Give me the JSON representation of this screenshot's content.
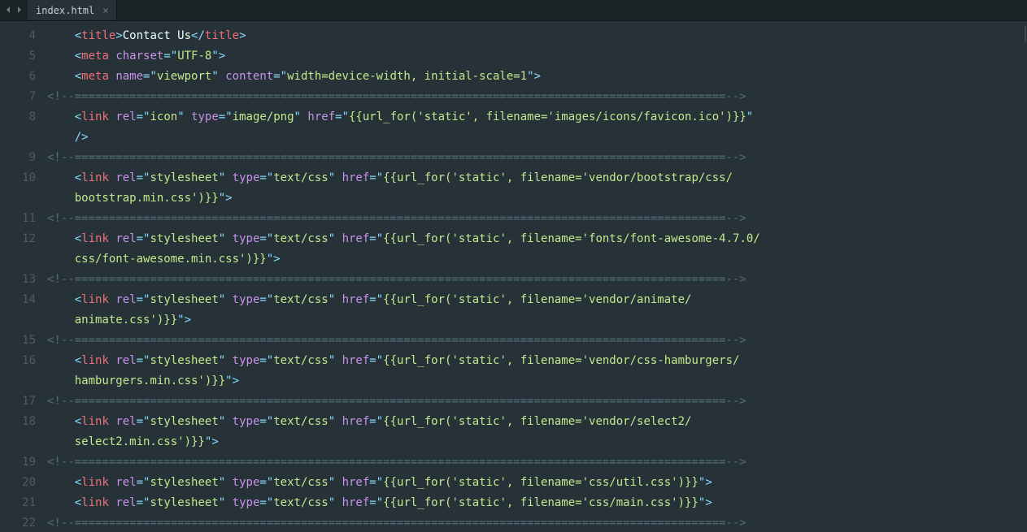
{
  "tab": {
    "filename": "index.html"
  },
  "gutter": [
    "4",
    "5",
    "6",
    "7",
    "8",
    "",
    "9",
    "10",
    "",
    "11",
    "12",
    "",
    "13",
    "14",
    "",
    "15",
    "16",
    "",
    "17",
    "18",
    "",
    "19",
    "20",
    "21",
    "22"
  ],
  "lines": [
    [
      {
        "k": "sp",
        "v": "    "
      },
      {
        "k": "punct",
        "v": "<"
      },
      {
        "k": "tagname",
        "v": "title"
      },
      {
        "k": "punct",
        "v": ">"
      },
      {
        "k": "text",
        "v": "Contact Us"
      },
      {
        "k": "punct",
        "v": "</"
      },
      {
        "k": "tagname",
        "v": "title"
      },
      {
        "k": "punct",
        "v": ">"
      }
    ],
    [
      {
        "k": "sp",
        "v": "    "
      },
      {
        "k": "punct",
        "v": "<"
      },
      {
        "k": "tagname",
        "v": "meta"
      },
      {
        "k": "sp",
        "v": " "
      },
      {
        "k": "attr",
        "v": "charset"
      },
      {
        "k": "op",
        "v": "="
      },
      {
        "k": "punct",
        "v": "\""
      },
      {
        "k": "str",
        "v": "UTF-8"
      },
      {
        "k": "punct",
        "v": "\""
      },
      {
        "k": "punct",
        "v": ">"
      }
    ],
    [
      {
        "k": "sp",
        "v": "    "
      },
      {
        "k": "punct",
        "v": "<"
      },
      {
        "k": "tagname",
        "v": "meta"
      },
      {
        "k": "sp",
        "v": " "
      },
      {
        "k": "attr",
        "v": "name"
      },
      {
        "k": "op",
        "v": "="
      },
      {
        "k": "punct",
        "v": "\""
      },
      {
        "k": "str",
        "v": "viewport"
      },
      {
        "k": "punct",
        "v": "\""
      },
      {
        "k": "sp",
        "v": " "
      },
      {
        "k": "attr",
        "v": "content"
      },
      {
        "k": "op",
        "v": "="
      },
      {
        "k": "punct",
        "v": "\""
      },
      {
        "k": "str",
        "v": "width=device-width, initial-scale=1"
      },
      {
        "k": "punct",
        "v": "\""
      },
      {
        "k": "punct",
        "v": ">"
      }
    ],
    [
      {
        "k": "comment",
        "v": "<!--===============================================================================================-->"
      }
    ],
    [
      {
        "k": "sp",
        "v": "    "
      },
      {
        "k": "punct",
        "v": "<"
      },
      {
        "k": "tagname",
        "v": "link"
      },
      {
        "k": "sp",
        "v": " "
      },
      {
        "k": "attr",
        "v": "rel"
      },
      {
        "k": "op",
        "v": "="
      },
      {
        "k": "punct",
        "v": "\""
      },
      {
        "k": "str",
        "v": "icon"
      },
      {
        "k": "punct",
        "v": "\""
      },
      {
        "k": "sp",
        "v": " "
      },
      {
        "k": "attr",
        "v": "type"
      },
      {
        "k": "op",
        "v": "="
      },
      {
        "k": "punct",
        "v": "\""
      },
      {
        "k": "str",
        "v": "image/png"
      },
      {
        "k": "punct",
        "v": "\""
      },
      {
        "k": "sp",
        "v": " "
      },
      {
        "k": "attr",
        "v": "href"
      },
      {
        "k": "op",
        "v": "="
      },
      {
        "k": "punct",
        "v": "\""
      },
      {
        "k": "str",
        "v": "{{url_for('static', filename='images/icons/favicon.ico')}}"
      },
      {
        "k": "punct",
        "v": "\""
      }
    ],
    [
      {
        "k": "sp",
        "v": "    "
      },
      {
        "k": "punct",
        "v": "/>"
      }
    ],
    [
      {
        "k": "comment",
        "v": "<!--===============================================================================================-->"
      }
    ],
    [
      {
        "k": "sp",
        "v": "    "
      },
      {
        "k": "punct",
        "v": "<"
      },
      {
        "k": "tagname",
        "v": "link"
      },
      {
        "k": "sp",
        "v": " "
      },
      {
        "k": "attr",
        "v": "rel"
      },
      {
        "k": "op",
        "v": "="
      },
      {
        "k": "punct",
        "v": "\""
      },
      {
        "k": "str",
        "v": "stylesheet"
      },
      {
        "k": "punct",
        "v": "\""
      },
      {
        "k": "sp",
        "v": " "
      },
      {
        "k": "attr",
        "v": "type"
      },
      {
        "k": "op",
        "v": "="
      },
      {
        "k": "punct",
        "v": "\""
      },
      {
        "k": "str",
        "v": "text/css"
      },
      {
        "k": "punct",
        "v": "\""
      },
      {
        "k": "sp",
        "v": " "
      },
      {
        "k": "attr",
        "v": "href"
      },
      {
        "k": "op",
        "v": "="
      },
      {
        "k": "punct",
        "v": "\""
      },
      {
        "k": "str",
        "v": "{{url_for('static', filename='vendor/bootstrap/css/"
      }
    ],
    [
      {
        "k": "sp",
        "v": "    "
      },
      {
        "k": "str",
        "v": "bootstrap.min.css')}}"
      },
      {
        "k": "punct",
        "v": "\""
      },
      {
        "k": "punct",
        "v": ">"
      }
    ],
    [
      {
        "k": "comment",
        "v": "<!--===============================================================================================-->"
      }
    ],
    [
      {
        "k": "sp",
        "v": "    "
      },
      {
        "k": "punct",
        "v": "<"
      },
      {
        "k": "tagname",
        "v": "link"
      },
      {
        "k": "sp",
        "v": " "
      },
      {
        "k": "attr",
        "v": "rel"
      },
      {
        "k": "op",
        "v": "="
      },
      {
        "k": "punct",
        "v": "\""
      },
      {
        "k": "str",
        "v": "stylesheet"
      },
      {
        "k": "punct",
        "v": "\""
      },
      {
        "k": "sp",
        "v": " "
      },
      {
        "k": "attr",
        "v": "type"
      },
      {
        "k": "op",
        "v": "="
      },
      {
        "k": "punct",
        "v": "\""
      },
      {
        "k": "str",
        "v": "text/css"
      },
      {
        "k": "punct",
        "v": "\""
      },
      {
        "k": "sp",
        "v": " "
      },
      {
        "k": "attr",
        "v": "href"
      },
      {
        "k": "op",
        "v": "="
      },
      {
        "k": "punct",
        "v": "\""
      },
      {
        "k": "str",
        "v": "{{url_for('static', filename='fonts/font-awesome-4.7.0/"
      }
    ],
    [
      {
        "k": "sp",
        "v": "    "
      },
      {
        "k": "str",
        "v": "css/font-awesome.min.css')}}"
      },
      {
        "k": "punct",
        "v": "\""
      },
      {
        "k": "punct",
        "v": ">"
      }
    ],
    [
      {
        "k": "comment",
        "v": "<!--===============================================================================================-->"
      }
    ],
    [
      {
        "k": "sp",
        "v": "    "
      },
      {
        "k": "punct",
        "v": "<"
      },
      {
        "k": "tagname",
        "v": "link"
      },
      {
        "k": "sp",
        "v": " "
      },
      {
        "k": "attr",
        "v": "rel"
      },
      {
        "k": "op",
        "v": "="
      },
      {
        "k": "punct",
        "v": "\""
      },
      {
        "k": "str",
        "v": "stylesheet"
      },
      {
        "k": "punct",
        "v": "\""
      },
      {
        "k": "sp",
        "v": " "
      },
      {
        "k": "attr",
        "v": "type"
      },
      {
        "k": "op",
        "v": "="
      },
      {
        "k": "punct",
        "v": "\""
      },
      {
        "k": "str",
        "v": "text/css"
      },
      {
        "k": "punct",
        "v": "\""
      },
      {
        "k": "sp",
        "v": " "
      },
      {
        "k": "attr",
        "v": "href"
      },
      {
        "k": "op",
        "v": "="
      },
      {
        "k": "punct",
        "v": "\""
      },
      {
        "k": "str",
        "v": "{{url_for('static', filename='vendor/animate/"
      }
    ],
    [
      {
        "k": "sp",
        "v": "    "
      },
      {
        "k": "str",
        "v": "animate.css')}}"
      },
      {
        "k": "punct",
        "v": "\""
      },
      {
        "k": "punct",
        "v": ">"
      }
    ],
    [
      {
        "k": "comment",
        "v": "<!--===============================================================================================-->"
      }
    ],
    [
      {
        "k": "sp",
        "v": "    "
      },
      {
        "k": "punct",
        "v": "<"
      },
      {
        "k": "tagname",
        "v": "link"
      },
      {
        "k": "sp",
        "v": " "
      },
      {
        "k": "attr",
        "v": "rel"
      },
      {
        "k": "op",
        "v": "="
      },
      {
        "k": "punct",
        "v": "\""
      },
      {
        "k": "str",
        "v": "stylesheet"
      },
      {
        "k": "punct",
        "v": "\""
      },
      {
        "k": "sp",
        "v": " "
      },
      {
        "k": "attr",
        "v": "type"
      },
      {
        "k": "op",
        "v": "="
      },
      {
        "k": "punct",
        "v": "\""
      },
      {
        "k": "str",
        "v": "text/css"
      },
      {
        "k": "punct",
        "v": "\""
      },
      {
        "k": "sp",
        "v": " "
      },
      {
        "k": "attr",
        "v": "href"
      },
      {
        "k": "op",
        "v": "="
      },
      {
        "k": "punct",
        "v": "\""
      },
      {
        "k": "str",
        "v": "{{url_for('static', filename='vendor/css-hamburgers/"
      }
    ],
    [
      {
        "k": "sp",
        "v": "    "
      },
      {
        "k": "str",
        "v": "hamburgers.min.css')}}"
      },
      {
        "k": "punct",
        "v": "\""
      },
      {
        "k": "punct",
        "v": ">"
      }
    ],
    [
      {
        "k": "comment",
        "v": "<!--===============================================================================================-->"
      }
    ],
    [
      {
        "k": "sp",
        "v": "    "
      },
      {
        "k": "punct",
        "v": "<"
      },
      {
        "k": "tagname",
        "v": "link"
      },
      {
        "k": "sp",
        "v": " "
      },
      {
        "k": "attr",
        "v": "rel"
      },
      {
        "k": "op",
        "v": "="
      },
      {
        "k": "punct",
        "v": "\""
      },
      {
        "k": "str",
        "v": "stylesheet"
      },
      {
        "k": "punct",
        "v": "\""
      },
      {
        "k": "sp",
        "v": " "
      },
      {
        "k": "attr",
        "v": "type"
      },
      {
        "k": "op",
        "v": "="
      },
      {
        "k": "punct",
        "v": "\""
      },
      {
        "k": "str",
        "v": "text/css"
      },
      {
        "k": "punct",
        "v": "\""
      },
      {
        "k": "sp",
        "v": " "
      },
      {
        "k": "attr",
        "v": "href"
      },
      {
        "k": "op",
        "v": "="
      },
      {
        "k": "punct",
        "v": "\""
      },
      {
        "k": "str",
        "v": "{{url_for('static', filename='vendor/select2/"
      }
    ],
    [
      {
        "k": "sp",
        "v": "    "
      },
      {
        "k": "str",
        "v": "select2.min.css')}}"
      },
      {
        "k": "punct",
        "v": "\""
      },
      {
        "k": "punct",
        "v": ">"
      }
    ],
    [
      {
        "k": "comment",
        "v": "<!--===============================================================================================-->"
      }
    ],
    [
      {
        "k": "sp",
        "v": "    "
      },
      {
        "k": "punct",
        "v": "<"
      },
      {
        "k": "tagname",
        "v": "link"
      },
      {
        "k": "sp",
        "v": " "
      },
      {
        "k": "attr",
        "v": "rel"
      },
      {
        "k": "op",
        "v": "="
      },
      {
        "k": "punct",
        "v": "\""
      },
      {
        "k": "str",
        "v": "stylesheet"
      },
      {
        "k": "punct",
        "v": "\""
      },
      {
        "k": "sp",
        "v": " "
      },
      {
        "k": "attr",
        "v": "type"
      },
      {
        "k": "op",
        "v": "="
      },
      {
        "k": "punct",
        "v": "\""
      },
      {
        "k": "str",
        "v": "text/css"
      },
      {
        "k": "punct",
        "v": "\""
      },
      {
        "k": "sp",
        "v": " "
      },
      {
        "k": "attr",
        "v": "href"
      },
      {
        "k": "op",
        "v": "="
      },
      {
        "k": "punct",
        "v": "\""
      },
      {
        "k": "str",
        "v": "{{url_for('static', filename='css/util.css')}}"
      },
      {
        "k": "punct",
        "v": "\""
      },
      {
        "k": "punct",
        "v": ">"
      }
    ],
    [
      {
        "k": "sp",
        "v": "    "
      },
      {
        "k": "punct",
        "v": "<"
      },
      {
        "k": "tagname",
        "v": "link"
      },
      {
        "k": "sp",
        "v": " "
      },
      {
        "k": "attr",
        "v": "rel"
      },
      {
        "k": "op",
        "v": "="
      },
      {
        "k": "punct",
        "v": "\""
      },
      {
        "k": "str",
        "v": "stylesheet"
      },
      {
        "k": "punct",
        "v": "\""
      },
      {
        "k": "sp",
        "v": " "
      },
      {
        "k": "attr",
        "v": "type"
      },
      {
        "k": "op",
        "v": "="
      },
      {
        "k": "punct",
        "v": "\""
      },
      {
        "k": "str",
        "v": "text/css"
      },
      {
        "k": "punct",
        "v": "\""
      },
      {
        "k": "sp",
        "v": " "
      },
      {
        "k": "attr",
        "v": "href"
      },
      {
        "k": "op",
        "v": "="
      },
      {
        "k": "punct",
        "v": "\""
      },
      {
        "k": "str",
        "v": "{{url_for('static', filename='css/main.css')}}"
      },
      {
        "k": "punct",
        "v": "\""
      },
      {
        "k": "punct",
        "v": ">"
      }
    ],
    [
      {
        "k": "comment",
        "v": "<!--===============================================================================================-->"
      }
    ]
  ]
}
